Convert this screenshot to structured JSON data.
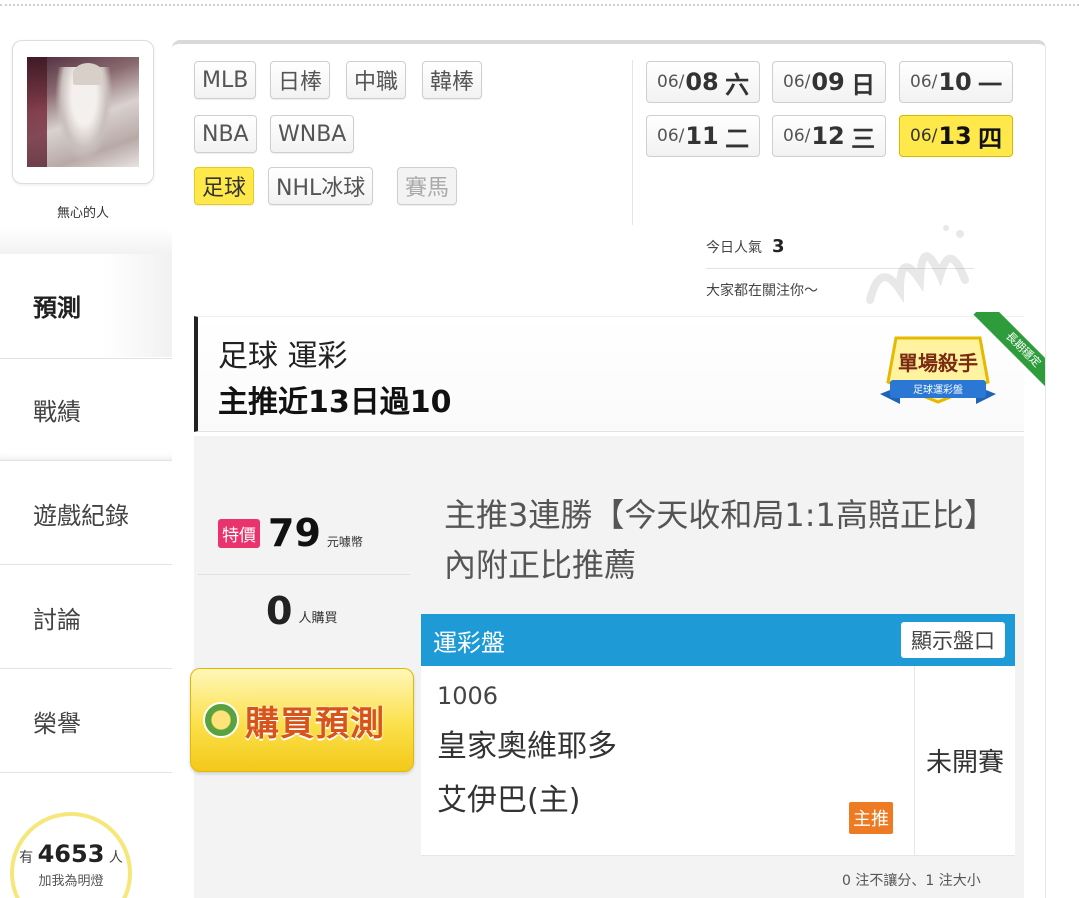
{
  "user": {
    "name": "無心的人"
  },
  "nav": [
    {
      "label": "預測",
      "active": true
    },
    {
      "label": "戰績"
    },
    {
      "label": "遊戲紀錄"
    },
    {
      "label": "討論"
    },
    {
      "label": "榮譽"
    }
  ],
  "fans": {
    "prefix": "有",
    "count": "4653",
    "suffix": "人",
    "cta": "加我為明燈"
  },
  "sports": [
    {
      "label": "MLB"
    },
    {
      "label": "日棒"
    },
    {
      "label": "中職"
    },
    {
      "label": "韓棒"
    },
    {
      "label": "NBA"
    },
    {
      "label": "WNBA"
    },
    {
      "label": "足球",
      "active": true
    },
    {
      "label": "NHL冰球"
    },
    {
      "label": "賽馬",
      "disabled": true
    }
  ],
  "dates": [
    {
      "prefix": "06/",
      "day": "08",
      "weekday": "六"
    },
    {
      "prefix": "06/",
      "day": "09",
      "weekday": "日"
    },
    {
      "prefix": "06/",
      "day": "10",
      "weekday": "一"
    },
    {
      "prefix": "06/",
      "day": "11",
      "weekday": "二"
    },
    {
      "prefix": "06/",
      "day": "12",
      "weekday": "三"
    },
    {
      "prefix": "06/",
      "day": "13",
      "weekday": "四",
      "active": true
    }
  ],
  "popularity": {
    "label": "今日人氣",
    "value": "3",
    "sub": "大家都在關注你〜"
  },
  "banner": {
    "line1": "足球 運彩",
    "line2": "主推近13日過10",
    "badge_main": "單場殺手",
    "badge_sub": "足球運彩盤",
    "ribbon": "長期穩定"
  },
  "offer": {
    "special_tag": "特價",
    "price": "79",
    "price_unit": "元噱幣",
    "buyers": "0",
    "buyers_unit": "人購買",
    "buy_button": "購買預測",
    "title": "主推3連勝【今天收和局1:1高賠正比】內附正比推薦"
  },
  "odds": {
    "header": "運彩盤",
    "show_button": "顯示盤口",
    "game_code": "1006",
    "team_line1": "皇家奧維耶多",
    "team_line2": "艾伊巴(主)",
    "pick_tag": "主推",
    "status": "未開賽",
    "note": "0 注不讓分、1 注大小"
  },
  "colors": {
    "accent_yellow": "#ffe94a",
    "odds_header_blue": "#1e9ad6",
    "special_pink": "#e8336d",
    "pick_orange": "#ee7a23"
  }
}
